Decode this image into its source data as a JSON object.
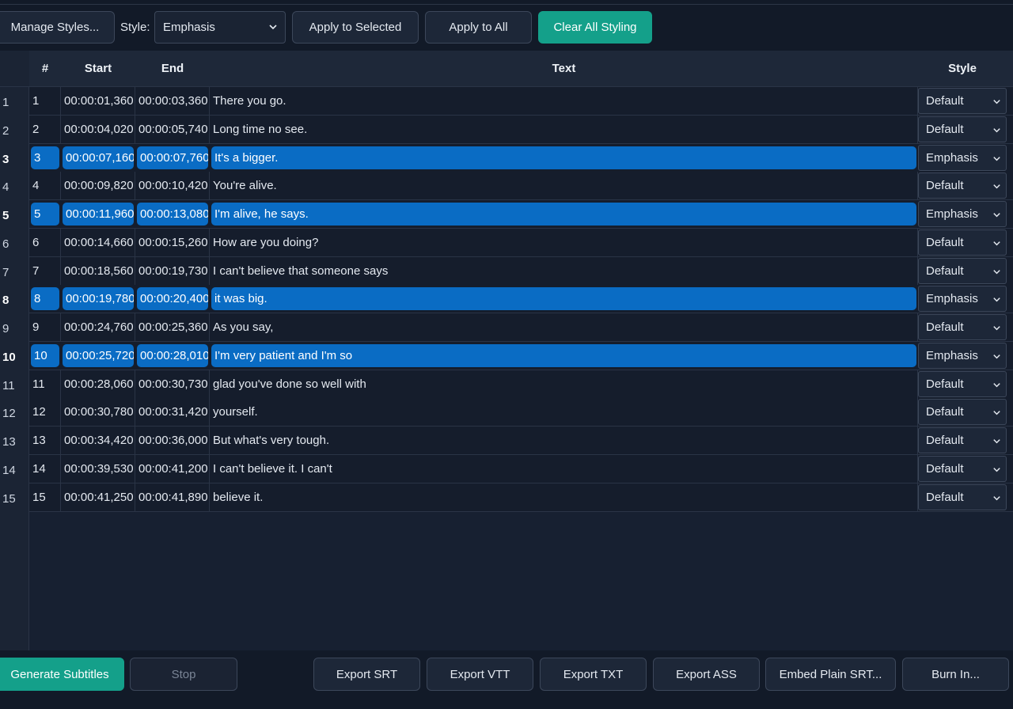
{
  "toolbar": {
    "manage_styles": "Manage Styles...",
    "style_label": "Style:",
    "style_value": "Emphasis",
    "apply_selected": "Apply to Selected",
    "apply_all": "Apply to All",
    "clear_styling": "Clear All Styling"
  },
  "table": {
    "headers": {
      "num": "#",
      "start": "Start",
      "end": "End",
      "text": "Text",
      "style": "Style"
    },
    "rows": [
      {
        "rn": "1",
        "num": "1",
        "start": "00:00:01,360",
        "end": "00:00:03,360",
        "text": "There you go.",
        "style": "Default",
        "selected": false
      },
      {
        "rn": "2",
        "num": "2",
        "start": "00:00:04,020",
        "end": "00:00:05,740",
        "text": "Long time no see.",
        "style": "Default",
        "selected": false
      },
      {
        "rn": "3",
        "num": "3",
        "start": "00:00:07,160",
        "end": "00:00:07,760",
        "text": "It's a bigger.",
        "style": "Emphasis",
        "selected": true
      },
      {
        "rn": "4",
        "num": "4",
        "start": "00:00:09,820",
        "end": "00:00:10,420",
        "text": "You're alive.",
        "style": "Default",
        "selected": false
      },
      {
        "rn": "5",
        "num": "5",
        "start": "00:00:11,960",
        "end": "00:00:13,080",
        "text": "I'm alive, he says.",
        "style": "Emphasis",
        "selected": true
      },
      {
        "rn": "6",
        "num": "6",
        "start": "00:00:14,660",
        "end": "00:00:15,260",
        "text": "How are you doing?",
        "style": "Default",
        "selected": false
      },
      {
        "rn": "7",
        "num": "7",
        "start": "00:00:18,560",
        "end": "00:00:19,730",
        "text": "I can't believe that someone says",
        "style": "Default",
        "selected": false
      },
      {
        "rn": "8",
        "num": "8",
        "start": "00:00:19,780",
        "end": "00:00:20,400",
        "text": "it was big.",
        "style": "Emphasis",
        "selected": true
      },
      {
        "rn": "9",
        "num": "9",
        "start": "00:00:24,760",
        "end": "00:00:25,360",
        "text": "As you say,",
        "style": "Default",
        "selected": false
      },
      {
        "rn": "10",
        "num": "10",
        "start": "00:00:25,720",
        "end": "00:00:28,010",
        "text": "I'm very patient and I'm so",
        "style": "Emphasis",
        "selected": true
      },
      {
        "rn": "11",
        "num": "11",
        "start": "00:00:28,060",
        "end": "00:00:30,730",
        "text": "glad you've done so well with",
        "style": "Default",
        "selected": false
      },
      {
        "rn": "12",
        "num": "12",
        "start": "00:00:30,780",
        "end": "00:00:31,420",
        "text": "yourself.",
        "style": "Default",
        "selected": false
      },
      {
        "rn": "13",
        "num": "13",
        "start": "00:00:34,420",
        "end": "00:00:36,000",
        "text": "But what's very tough.",
        "style": "Default",
        "selected": false
      },
      {
        "rn": "14",
        "num": "14",
        "start": "00:00:39,530",
        "end": "00:00:41,200",
        "text": "I can't believe it. I can't",
        "style": "Default",
        "selected": false
      },
      {
        "rn": "15",
        "num": "15",
        "start": "00:00:41,250",
        "end": "00:00:41,890",
        "text": "believe it.",
        "style": "Default",
        "selected": false
      }
    ]
  },
  "bottom": {
    "generate": "Generate Subtitles",
    "stop": "Stop",
    "export_srt": "Export SRT",
    "export_vtt": "Export VTT",
    "export_txt": "Export TXT",
    "export_ass": "Export ASS",
    "embed_srt": "Embed Plain SRT...",
    "burn_in": "Burn In..."
  },
  "colors": {
    "accent": "#14a08a",
    "selection": "#0a6cc4",
    "background": "#121a28"
  }
}
